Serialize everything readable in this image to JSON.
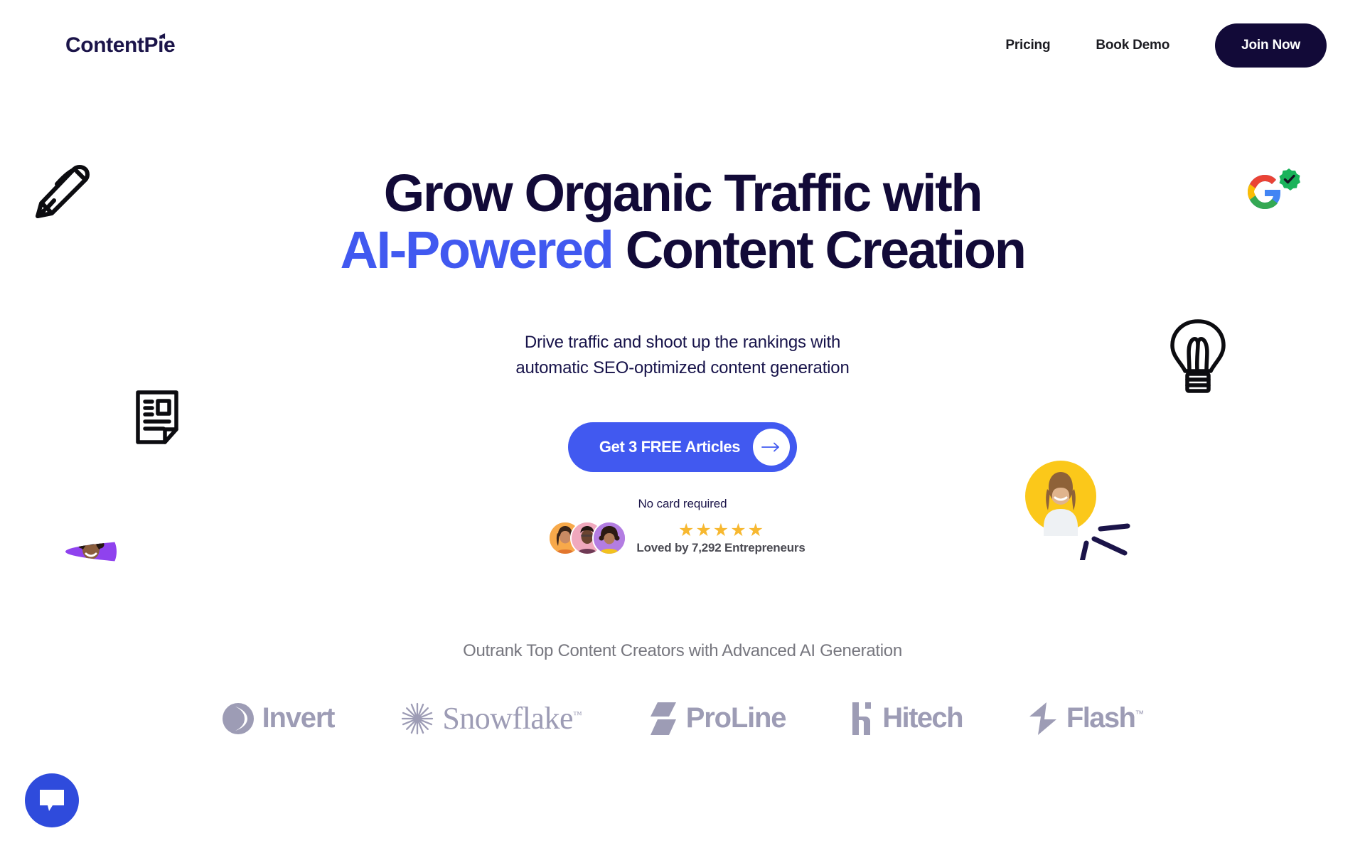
{
  "brand": {
    "name": "ContentPie",
    "navy": "#120a38",
    "blue": "#4159f0",
    "gold": "#f7b830",
    "muted": "#9d9cb5"
  },
  "header": {
    "nav_links": [
      {
        "label": "Pricing"
      },
      {
        "label": "Book Demo"
      }
    ],
    "cta_label": "Join Now"
  },
  "hero": {
    "headline_line1": "Grow Organic Traffic with",
    "headline_accent": "AI-Powered",
    "headline_line2_rest": " Content Creation",
    "subhead_line1": "Drive traffic and shoot up the rankings with",
    "subhead_line2": "automatic SEO-optimized content generation",
    "cta_label": "Get 3 FREE Articles",
    "cta_arrow": "arrow-right-icon",
    "no_card_text": "No card required",
    "stars": [
      "★",
      "★",
      "★",
      "★",
      "★"
    ],
    "star_count": 5,
    "loved_text": "Loved by 7,292 Entrepreneurs",
    "avatar_count": 3
  },
  "logos_section": {
    "label": "Outrank Top Content Creators with Advanced AI Generation",
    "brands": [
      {
        "name": "Invert",
        "icon": "invert-crescent-icon",
        "tm": ""
      },
      {
        "name": "Snowflake",
        "icon": "snowflake-burst-icon",
        "tm": "™"
      },
      {
        "name": "ProLine",
        "icon": "proline-bolt-icon",
        "tm": ""
      },
      {
        "name": "Hitech",
        "icon": "hitech-h-icon",
        "tm": ""
      },
      {
        "name": "Flash",
        "icon": "flash-bolt-icon",
        "tm": "™"
      }
    ]
  },
  "decorations": [
    {
      "name": "pen-icon"
    },
    {
      "name": "document-icon"
    },
    {
      "name": "lightbulb-icon"
    },
    {
      "name": "google-verified-icon"
    },
    {
      "name": "avatar-purple"
    },
    {
      "name": "avatar-yellow"
    }
  ],
  "chat": {
    "icon": "chat-bubble-icon"
  }
}
